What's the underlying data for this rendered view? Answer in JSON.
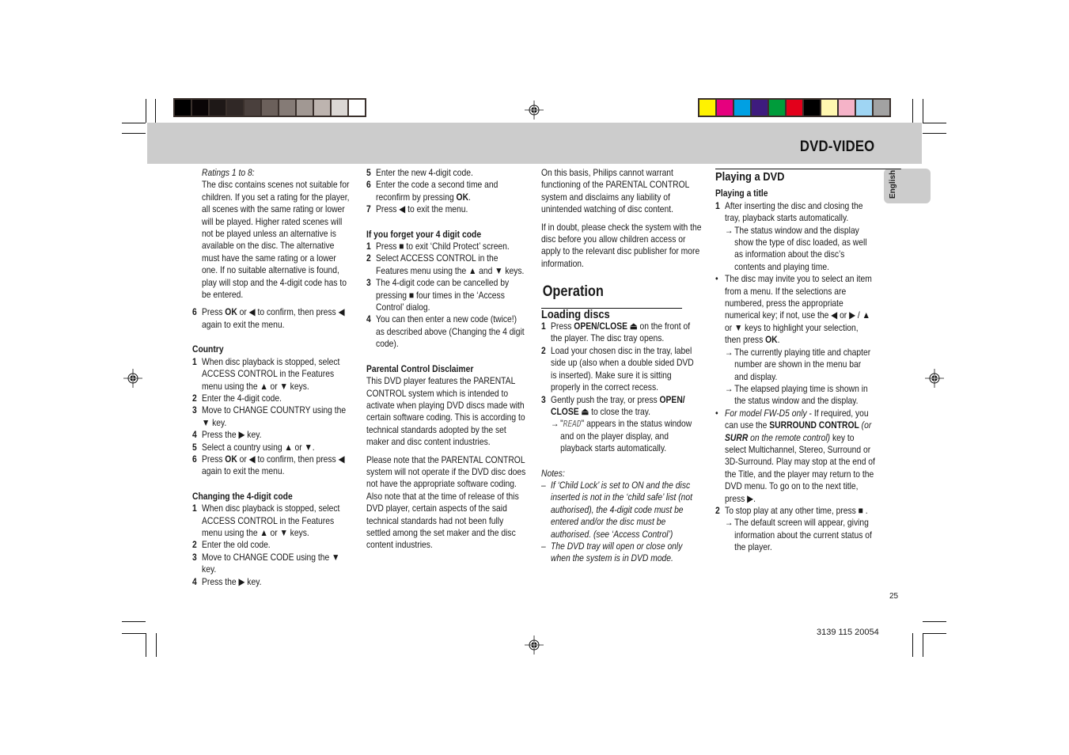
{
  "colors": {
    "band": "#cccccc",
    "grayscale": [
      "#000000",
      "#0a0506",
      "#1e1817",
      "#302826",
      "#4a403d",
      "#6b605b",
      "#857b76",
      "#a19893",
      "#bdb4af",
      "#dbd7d4",
      "#ffffff"
    ],
    "process": [
      "#fff200",
      "#e6007e",
      "#00a0e3",
      "#3e1b7e",
      "#009c3b",
      "#e3001b",
      "#000000",
      "#fff7b0",
      "#f5b3c8",
      "#9fd5f3",
      "#a2a2a2"
    ]
  },
  "header": {
    "section_title": "DVD-VIDEO",
    "language_tab": "English"
  },
  "col1": {
    "ratings_label": "Ratings 1 to 8:",
    "ratings_text": "The disc contains scenes not suitable for children. If you set a rating for the player, all scenes with the same rating or lower will be played. Higher rated scenes will not be played unless an alternative is available on the disc. The alternative must have the same rating or a lower one. If no suitable alternative is found, play will stop and the 4-digit code has to be entered.",
    "step6": {
      "n": "6",
      "pre": "Press ",
      "bold": "OK",
      "post": " or ◀ to confirm, then press ◀ again to exit the menu."
    },
    "country": {
      "heading": "Country",
      "steps": [
        {
          "n": "1",
          "pre": "When disc playback is stopped, select ",
          "key": "ACCESS CONTROL",
          "post": " in the Features menu using the ▲ or ▼ keys."
        },
        {
          "n": "2",
          "text": "Enter the 4-digit code."
        },
        {
          "n": "3",
          "pre": "Move to ",
          "key": "CHANGE COUNTRY",
          "post": " using the ▼ key."
        },
        {
          "n": "4",
          "text": "Press the ▶ key."
        },
        {
          "n": "5",
          "text": "Select a country using ▲ or ▼."
        },
        {
          "n": "6",
          "pre": "Press ",
          "bold": "OK",
          "post": " or ◀ to confirm, then press ◀ again to exit the menu."
        }
      ]
    },
    "change_code": {
      "heading": "Changing the 4-digit code",
      "steps": [
        {
          "n": "1",
          "pre": "When disc playback is stopped, select ",
          "key": "ACCESS CONTROL",
          "post": " in the Features menu using the ▲ or ▼ keys."
        },
        {
          "n": "2",
          "text": "Enter the old code."
        },
        {
          "n": "3",
          "pre": "Move to ",
          "key": "CHANGE CODE",
          "post": " using the ▼ key."
        },
        {
          "n": "4",
          "text": "Press the ▶ key."
        }
      ]
    }
  },
  "col2": {
    "steps": [
      {
        "n": "5",
        "text": "Enter the new 4-digit code."
      },
      {
        "n": "6",
        "pre": "Enter the code a second time and reconfirm by pressing ",
        "bold": "OK",
        "post": "."
      },
      {
        "n": "7",
        "text": "Press ◀ to exit the menu."
      }
    ],
    "forget": {
      "heading": "If you forget your 4 digit code",
      "steps": [
        {
          "n": "1",
          "text": "Press ■ to exit ‘Child Protect’ screen."
        },
        {
          "n": "2",
          "pre": "Select ",
          "key": "ACCESS CONTROL",
          "post": " in the Features menu using the ▲ and ▼ keys."
        },
        {
          "n": "3",
          "text": "The 4-digit code can be cancelled by pressing ■ four times in the ‘Access Control’ dialog."
        },
        {
          "n": "4",
          "text": "You can then enter a new code (twice!) as described above (Changing the 4 digit code)."
        }
      ]
    },
    "disclaimer": {
      "heading": "Parental Control Disclaimer",
      "p1": "This DVD player features the PARENTAL CONTROL system which is intended to activate when playing DVD discs made with certain software coding. This is according to technical standards adopted by the set maker and disc content industries.",
      "p2": "Please note that the PARENTAL CONTROL system will not operate if the DVD disc does not have the appropriate software coding. Also note that at the time of release of this DVD player, certain aspects of the said technical standards had not been fully settled among the set maker and the disc content industries."
    }
  },
  "col3": {
    "p1": "On this basis, Philips cannot warrant functioning of the PARENTAL CONTROL system and disclaims any liability of unintended watching of disc content.",
    "p2": "If in doubt, please check the system with the disc before you allow children access or apply to the relevant disc publisher for more information.",
    "operation_heading": "Operation",
    "loading_heading": "Loading discs",
    "steps": [
      {
        "n": "1",
        "pre": "Press ",
        "bold": "OPEN/CLOSE ⏏",
        "post": "  on the front of the player. The disc tray opens."
      },
      {
        "n": "2",
        "text": "Load your chosen disc in the tray, label side up (also when a double sided DVD is inserted). Make sure it is sitting properly in the correct recess."
      },
      {
        "n": "3",
        "pre": "Gently push the tray, or press ",
        "bold": "OPEN/ CLOSE ⏏",
        "post": "  to close the tray."
      }
    ],
    "arrow": {
      "lcd": "READ",
      "text": " appears in the status window and on the player display, and playback starts automatically."
    },
    "notes_label": "Notes:",
    "notes": [
      "If ‘Child Lock’ is set to ON and the disc inserted is not in the ‘child safe’ list (not authorised), the 4-digit code must be entered and/or the disc must be authorised. (see ‘Access Control’)",
      "The DVD tray will open or close only when the system is in DVD mode."
    ]
  },
  "col4": {
    "heading": "Playing a DVD",
    "subheading": "Playing a title",
    "step1": {
      "n": "1",
      "text": "After inserting the disc and closing the tray, playback starts automatically."
    },
    "step1_arrow": "The status window and the display show the type of disc loaded, as well as information about the disc’s contents and playing time.",
    "bullet1": {
      "pre": "The disc may invite you to select an item from a menu. If the selections are numbered, press the appropriate numerical key; if not, use the ◀ or ▶ / ▲ or ▼ keys to highlight your selection, then press ",
      "bold": "OK",
      "post": "."
    },
    "bullet1_arrows": [
      "The currently playing title and chapter number are shown in the menu bar and display.",
      "The elapsed playing time is shown in the status window and the display."
    ],
    "bullet2": {
      "it1": "For model FW-D5 only",
      "t1": " - If required, you can use the ",
      "b1": "SURROUND CONTROL",
      "it2": " (or ",
      "bi": "SURR",
      "it3": " on the remote control)",
      "t2": " key to select Multichannel, Stereo, Surround or 3D-Surround. Play may stop at the end of the Title, and the player may return to the DVD menu. To go on to the next title, press ▶."
    },
    "step2": {
      "n": "2",
      "text": "To stop play at any other time, press ■ ."
    },
    "step2_arrow": "The default screen will appear, giving information about the current status of the player."
  },
  "footer": {
    "page_number": "25",
    "doc_code": "3139 115 20054"
  }
}
